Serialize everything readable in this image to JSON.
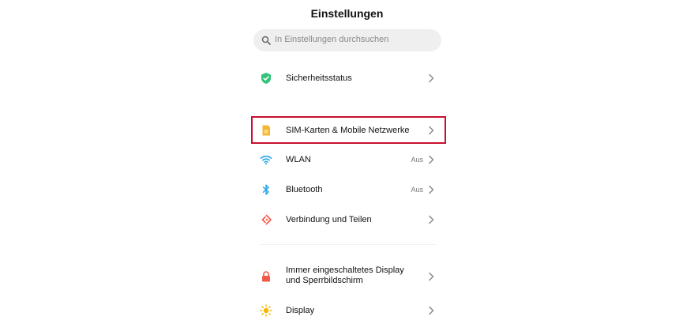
{
  "header": {
    "title": "Einstellungen"
  },
  "search": {
    "placeholder": "In Einstellungen durchsuchen"
  },
  "items": [
    {
      "label": "Sicherheitsstatus",
      "icon": "shield-check-icon",
      "value": ""
    },
    {
      "label": "SIM-Karten & Mobile Netzwerke",
      "icon": "sim-card-icon",
      "value": ""
    },
    {
      "label": "WLAN",
      "icon": "wifi-icon",
      "value": "Aus"
    },
    {
      "label": "Bluetooth",
      "icon": "bluetooth-icon",
      "value": "Aus"
    },
    {
      "label": "Verbindung und Teilen",
      "icon": "share-connection-icon",
      "value": ""
    },
    {
      "label_line1": "Immer eingeschaltetes Display",
      "label_line2": "und Sperrbildschirm",
      "icon": "lock-icon",
      "value": ""
    },
    {
      "label": "Display",
      "icon": "sun-icon",
      "value": ""
    }
  ],
  "colors": {
    "shield": "#33c27a",
    "sim": "#f5b731",
    "wifi": "#2aa7e8",
    "bluetooth": "#2aa7e8",
    "share": "#f05b4a",
    "lock": "#f05b4a",
    "sun": "#f7b500",
    "highlight": "#c8102e"
  }
}
